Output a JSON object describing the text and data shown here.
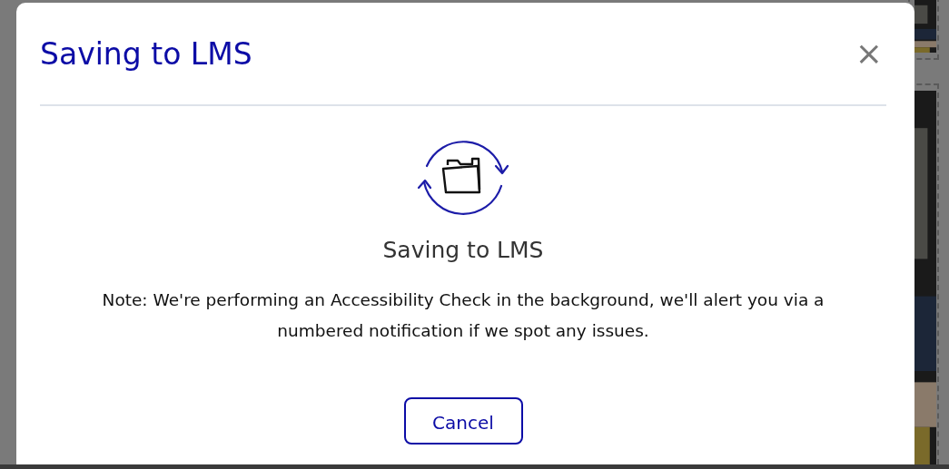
{
  "dialog": {
    "title": "Saving to LMS",
    "close": "×",
    "status": "Saving to LMS",
    "note": "Note: We're performing an Accessibility Check in the background, we'll alert you via a numbered notification if we spot any issues.",
    "buttons": [
      "Cancel"
    ]
  }
}
